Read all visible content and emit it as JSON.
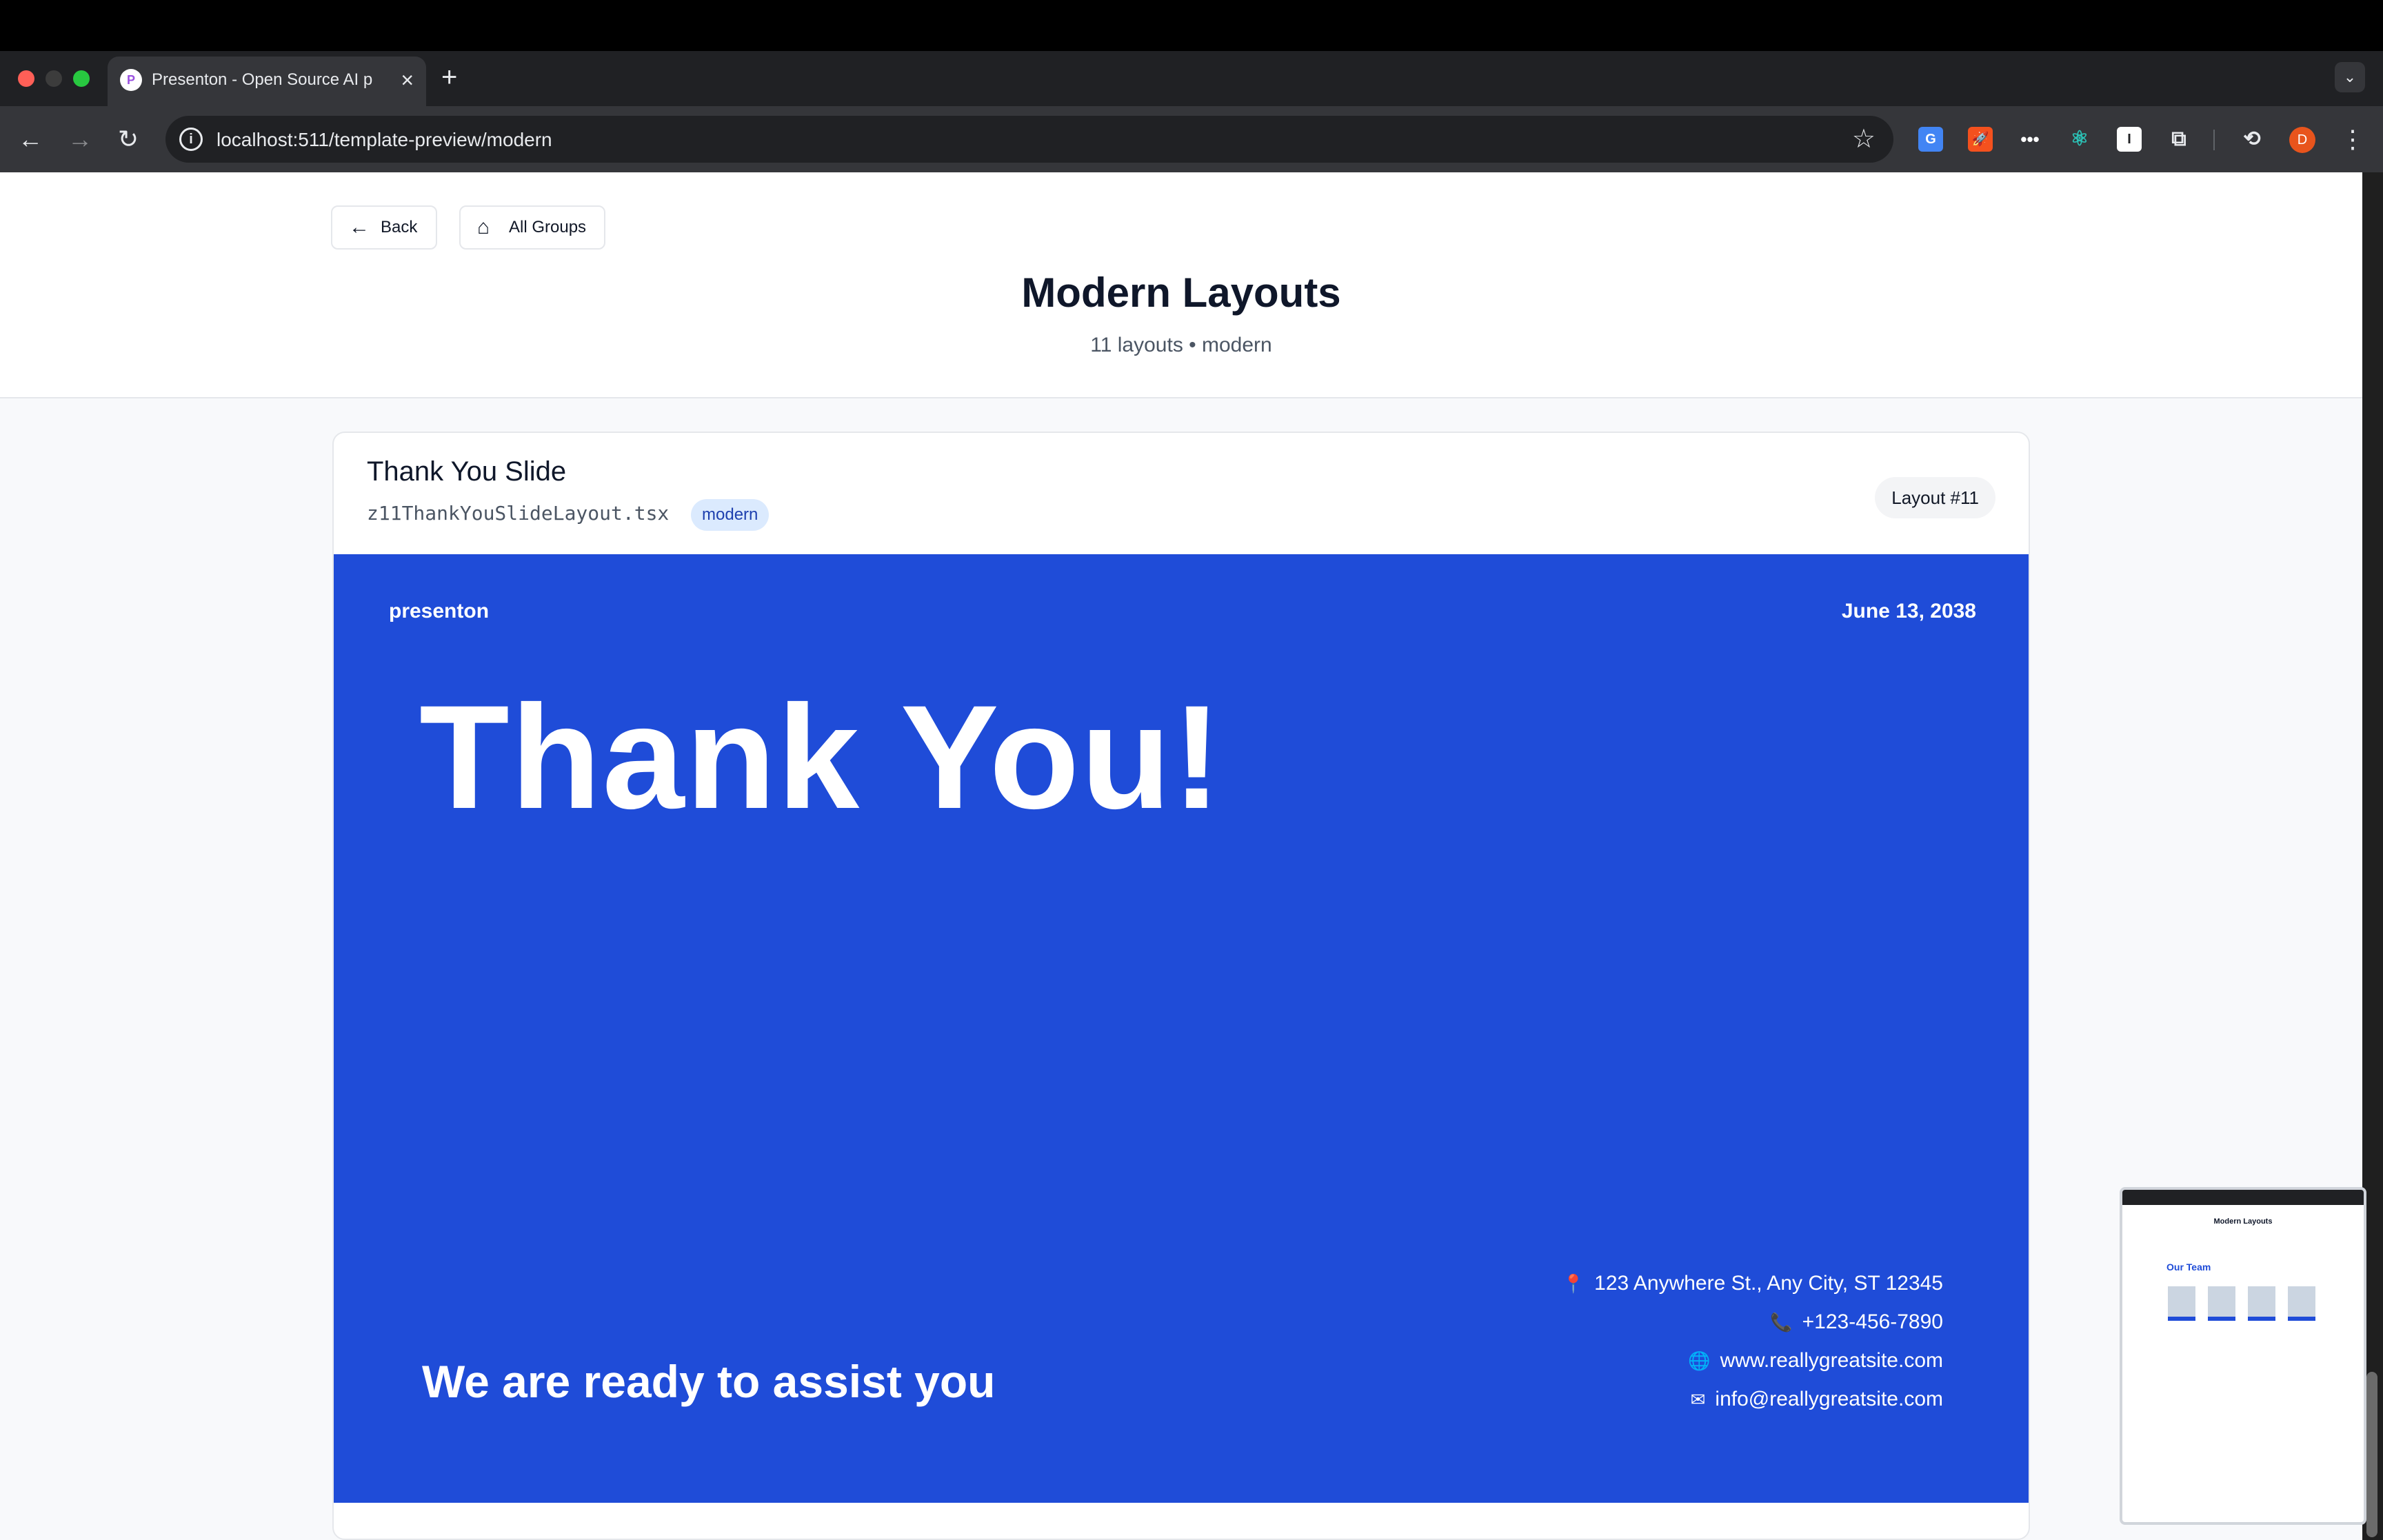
{
  "browser": {
    "tab_title": "Presenton - Open Source AI p",
    "tab_favicon": "P",
    "url": "localhost:511/template-preview/modern",
    "profile_initial": "D"
  },
  "header": {
    "back_label": "Back",
    "groups_label": "All Groups",
    "title": "Modern Layouts",
    "subtitle": "11 layouts • modern"
  },
  "card": {
    "title": "Thank You Slide",
    "file": "z11ThankYouSlideLayout.tsx",
    "tag": "modern",
    "layout_number": "Layout #11"
  },
  "slide": {
    "brand": "presenton",
    "date": "June 13, 2038",
    "heading": "Thank You!",
    "tagline": "We are ready to assist you",
    "contacts": {
      "address": "123 Anywhere St., Any City, ST 12345",
      "phone": "+123-456-7890",
      "website": "www.reallygreatsite.com",
      "email": "info@reallygreatsite.com"
    }
  },
  "thumbnail": {
    "title": "Modern Layouts",
    "heading": "Our Team"
  },
  "colors": {
    "slide_bg": "#1f4cd8",
    "tag_bg": "#dbeafe",
    "tag_text": "#1e40af"
  },
  "icons": [
    "back-arrow-icon",
    "forward-arrow-icon",
    "reload-icon",
    "info-icon",
    "star-icon",
    "home-icon",
    "pin-icon",
    "phone-icon",
    "globe-icon",
    "envelope-icon",
    "close-icon",
    "plus-icon",
    "chevron-down-icon",
    "kebab-menu-icon"
  ]
}
